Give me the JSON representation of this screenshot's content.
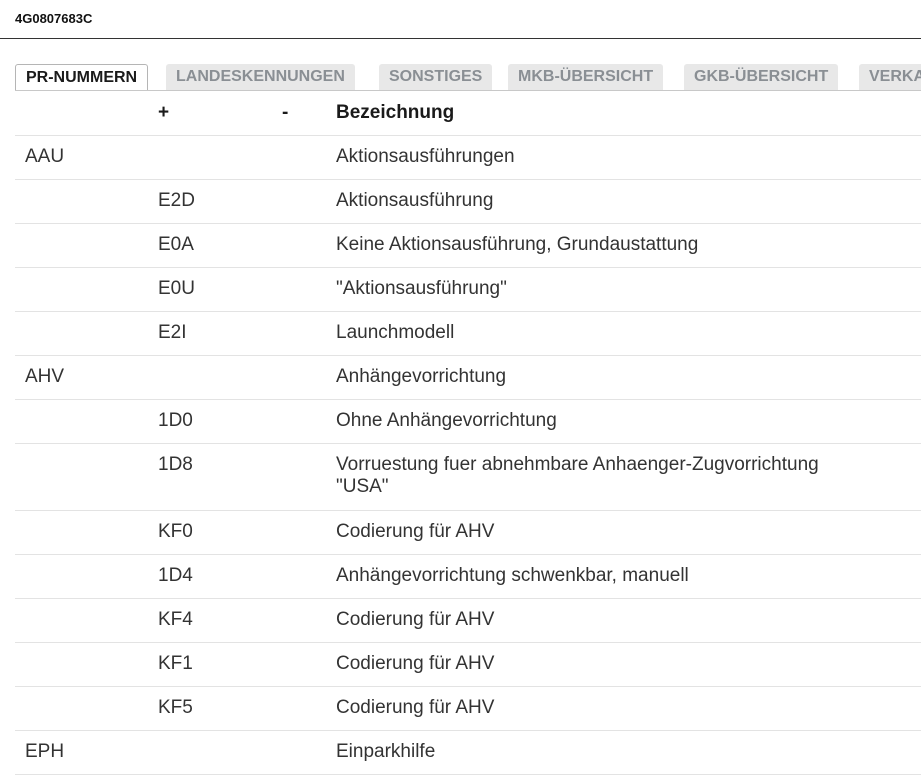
{
  "header": {
    "title": "4G0807683C"
  },
  "tabs": [
    {
      "label": "PR-NUMMERN",
      "active": true
    },
    {
      "label": "LANDESKENNUNGEN",
      "active": false
    },
    {
      "label": "SONSTIGES",
      "active": false
    },
    {
      "label": "MKB-ÜBERSICHT",
      "active": false
    },
    {
      "label": "GKB-ÜBERSICHT",
      "active": false
    },
    {
      "label": "VERKAUFSTYPEN",
      "active": false
    }
  ],
  "table": {
    "columns": {
      "code": "",
      "plus": "+",
      "minus": "-",
      "desc": "Bezeichnung"
    },
    "rows": [
      {
        "code": "AAU",
        "plus": "",
        "minus": "",
        "desc": "Aktionsausführungen"
      },
      {
        "code": "",
        "plus": "E2D",
        "minus": "",
        "desc": "Aktionsausführung"
      },
      {
        "code": "",
        "plus": "E0A",
        "minus": "",
        "desc": "Keine Aktionsausführung, Grundaustattung"
      },
      {
        "code": "",
        "plus": "E0U",
        "minus": "",
        "desc": "\"Aktionsausführung\""
      },
      {
        "code": "",
        "plus": "E2I",
        "minus": "",
        "desc": "Launchmodell"
      },
      {
        "code": "AHV",
        "plus": "",
        "minus": "",
        "desc": "Anhängevorrichtung"
      },
      {
        "code": "",
        "plus": "1D0",
        "minus": "",
        "desc": "Ohne Anhängevorrichtung"
      },
      {
        "code": "",
        "plus": "1D8",
        "minus": "",
        "desc": "Vorruestung fuer abnehmbare Anhaenger-Zugvorrichtung \"USA\""
      },
      {
        "code": "",
        "plus": "KF0",
        "minus": "",
        "desc": "Codierung für AHV"
      },
      {
        "code": "",
        "plus": "1D4",
        "minus": "",
        "desc": "Anhängevorrichtung schwenkbar, manuell"
      },
      {
        "code": "",
        "plus": "KF4",
        "minus": "",
        "desc": "Codierung für AHV"
      },
      {
        "code": "",
        "plus": "KF1",
        "minus": "",
        "desc": "Codierung für AHV"
      },
      {
        "code": "",
        "plus": "KF5",
        "minus": "",
        "desc": "Codierung für AHV"
      },
      {
        "code": "EPH",
        "plus": "",
        "minus": "",
        "desc": "Einparkhilfe"
      }
    ]
  }
}
